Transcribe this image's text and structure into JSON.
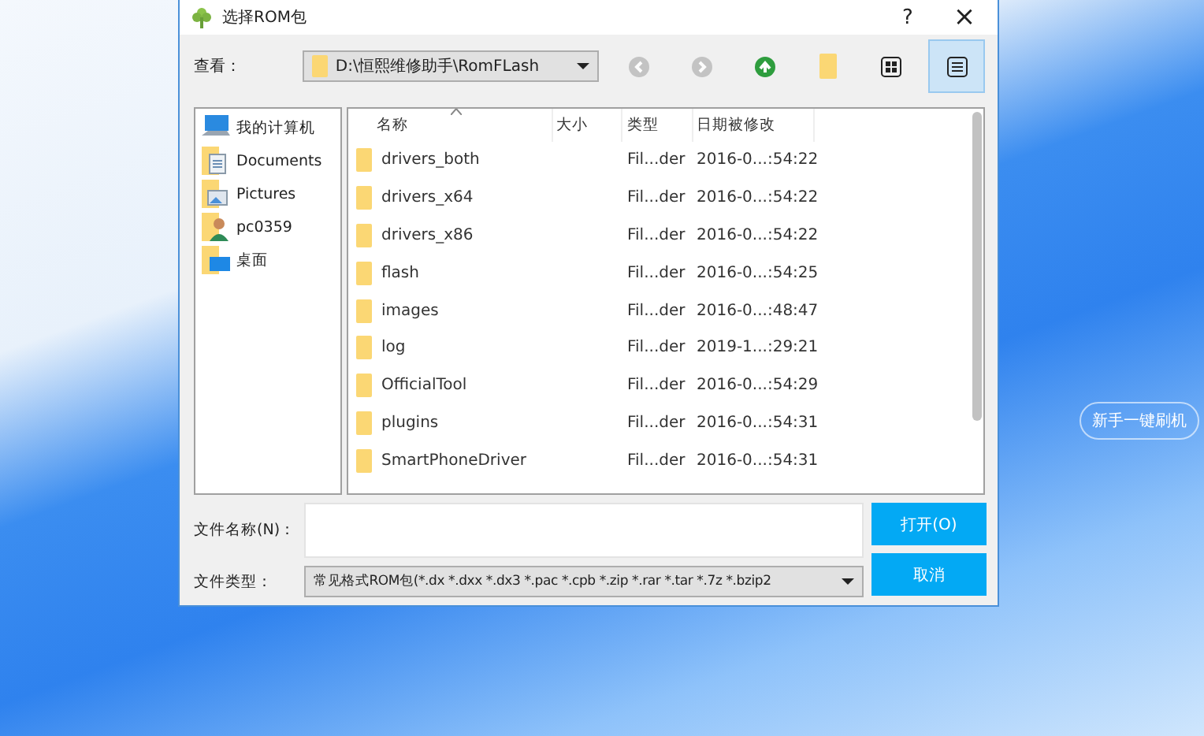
{
  "window": {
    "title": "选择ROM包",
    "help": "?",
    "close": "×"
  },
  "toolbar": {
    "look_in_label": "查看：",
    "path": "D:\\恒熙维修助手\\RomFLash",
    "buttons": [
      {
        "kind": "back",
        "disabled": true,
        "selected": false
      },
      {
        "kind": "forward",
        "disabled": true,
        "selected": false
      },
      {
        "kind": "up",
        "disabled": false,
        "selected": false
      },
      {
        "kind": "new-folder",
        "disabled": false,
        "selected": false
      },
      {
        "kind": "list-view",
        "disabled": false,
        "selected": false
      },
      {
        "kind": "detail-view",
        "disabled": false,
        "selected": true
      }
    ]
  },
  "sidebar": {
    "items": [
      {
        "kind": "computer",
        "label": "我的计算机"
      },
      {
        "kind": "documents",
        "label": "Documents"
      },
      {
        "kind": "pictures",
        "label": "Pictures"
      },
      {
        "kind": "user",
        "label": "pc0359"
      },
      {
        "kind": "desktop",
        "label": "桌面"
      }
    ]
  },
  "table": {
    "columns": [
      {
        "label": "名称",
        "sorted": true
      },
      {
        "label": "大小",
        "sorted": false
      },
      {
        "label": "类型",
        "sorted": false
      },
      {
        "label": "日期被修改",
        "sorted": false
      }
    ],
    "rows": [
      {
        "name": "drivers_both",
        "type": "Fil...der",
        "date": "2016-0...:54:22"
      },
      {
        "name": "drivers_x64",
        "type": "Fil...der",
        "date": "2016-0...:54:22"
      },
      {
        "name": "drivers_x86",
        "type": "Fil...der",
        "date": "2016-0...:54:22"
      },
      {
        "name": "flash",
        "type": "Fil...der",
        "date": "2016-0...:54:25"
      },
      {
        "name": "images",
        "type": "Fil...der",
        "date": "2016-0...:48:47"
      },
      {
        "name": "log",
        "type": "Fil...der",
        "date": "2019-1...:29:21"
      },
      {
        "name": "OfficialTool",
        "type": "Fil...der",
        "date": "2016-0...:54:29"
      },
      {
        "name": "plugins",
        "type": "Fil...der",
        "date": "2016-0...:54:31"
      },
      {
        "name": "SmartPhoneDriver",
        "type": "Fil...der",
        "date": "2016-0...:54:31"
      }
    ]
  },
  "file_name": {
    "label": "文件名称(N)："
  },
  "file_type": {
    "label": "文件类型：",
    "value": "常见格式ROM包(*.dx *.dxx *.dx3 *.pac *.cpb *.zip *.rar *.tar *.7z *.bzip2"
  },
  "buttons": [
    {
      "label": "打开(O)"
    },
    {
      "label": "取消"
    }
  ],
  "background": {
    "quick_flash_button": "新手一键刷机"
  }
}
